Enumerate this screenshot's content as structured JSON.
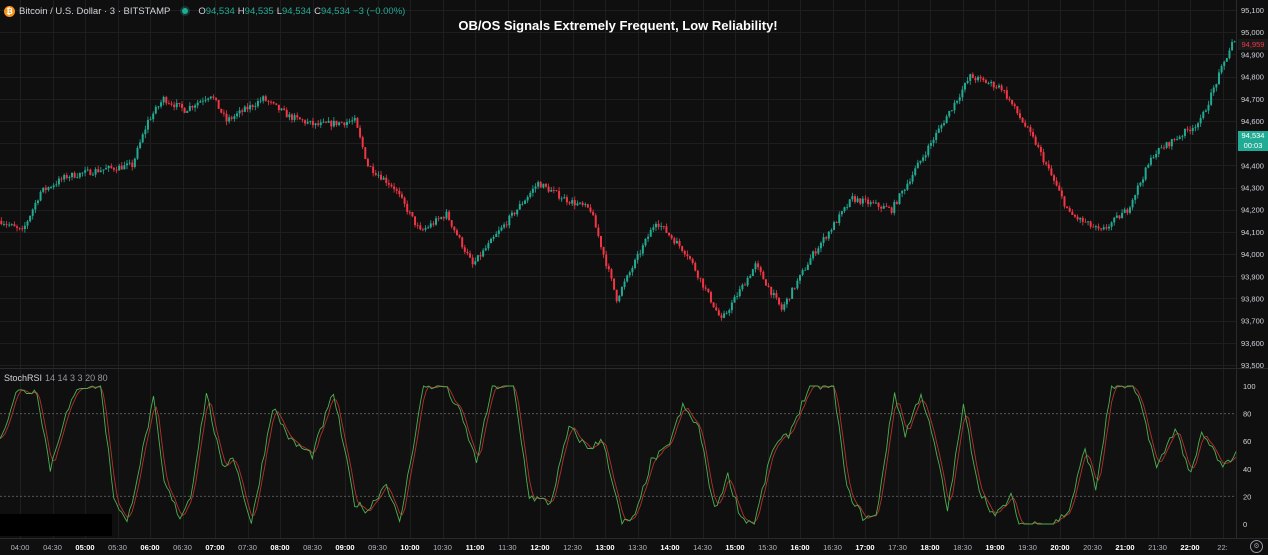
{
  "legend": {
    "symbol": "Bitcoin / U.S. Dollar · 3 · BITSTAMP",
    "icon": "bitcoin-icon",
    "status_color": "#22ab94",
    "o_label": "O",
    "o_value": "94,534",
    "h_label": "H",
    "h_value": "94,535",
    "l_label": "L",
    "l_value": "94,534",
    "c_label": "C",
    "c_value": "94,534",
    "change": "−3 (−0.00%)"
  },
  "title": "OB/OS Signals Extremely Frequent, Low Reliability!",
  "price_axis": {
    "labels": [
      "95,100",
      "95,000",
      "94,900",
      "94,800",
      "94,700",
      "94,600",
      "94,500",
      "94,400",
      "94,300",
      "94,200",
      "94,100",
      "94,000",
      "93,900",
      "93,800",
      "93,700",
      "93,600",
      "93,500"
    ],
    "last_price": "94,534",
    "countdown": "00:03",
    "high_marker": "94,959"
  },
  "indicator": {
    "name": "StochRSI",
    "params": "14 14 3 3 20 80",
    "levels": [
      "100",
      "80",
      "60",
      "40",
      "20",
      "0"
    ]
  },
  "time_axis": {
    "labels": [
      "04:00",
      "04:30",
      "05:00",
      "05:30",
      "06:00",
      "06:30",
      "07:00",
      "07:30",
      "08:00",
      "08:30",
      "09:00",
      "09:30",
      "10:00",
      "10:30",
      "11:00",
      "11:30",
      "12:00",
      "12:30",
      "13:00",
      "13:30",
      "14:00",
      "14:30",
      "15:00",
      "15:30",
      "16:00",
      "16:30",
      "17:00",
      "17:30",
      "18:00",
      "18:30",
      "19:00",
      "19:30",
      "20:00",
      "20:30",
      "21:00",
      "21:30",
      "22:00",
      "22:"
    ],
    "bold": [
      "05:00",
      "06:00",
      "07:00",
      "08:00",
      "09:00",
      "10:00",
      "11:00",
      "12:00",
      "13:00",
      "14:00",
      "15:00",
      "16:00",
      "17:00",
      "18:00",
      "19:00",
      "20:00",
      "21:00",
      "22:00"
    ]
  },
  "colors": {
    "up": "#22ab94",
    "down": "#f23645",
    "k_line": "#4caf50",
    "d_line": "#b2302f",
    "background": "#0f0f0f",
    "grid": "#1e1e1e"
  },
  "chart_data": {
    "type": "candlestick",
    "x_range": [
      "03:48",
      "22:33"
    ],
    "price_range": [
      93500,
      95100
    ],
    "anchors": [
      [
        0,
        94150
      ],
      [
        8,
        94100
      ],
      [
        15,
        94280
      ],
      [
        25,
        94350
      ],
      [
        38,
        94380
      ],
      [
        50,
        94400
      ],
      [
        56,
        94600
      ],
      [
        62,
        94700
      ],
      [
        70,
        94650
      ],
      [
        80,
        94720
      ],
      [
        86,
        94600
      ],
      [
        100,
        94700
      ],
      [
        110,
        94620
      ],
      [
        120,
        94580
      ],
      [
        135,
        94600
      ],
      [
        140,
        94400
      ],
      [
        150,
        94300
      ],
      [
        160,
        94100
      ],
      [
        170,
        94180
      ],
      [
        180,
        93950
      ],
      [
        190,
        94100
      ],
      [
        205,
        94320
      ],
      [
        215,
        94250
      ],
      [
        225,
        94200
      ],
      [
        235,
        93800
      ],
      [
        250,
        94150
      ],
      [
        262,
        94000
      ],
      [
        275,
        93700
      ],
      [
        288,
        93950
      ],
      [
        298,
        93750
      ],
      [
        310,
        94000
      ],
      [
        325,
        94250
      ],
      [
        340,
        94200
      ],
      [
        355,
        94500
      ],
      [
        370,
        94800
      ],
      [
        382,
        94750
      ],
      [
        395,
        94500
      ],
      [
        408,
        94180
      ],
      [
        420,
        94100
      ],
      [
        430,
        94200
      ],
      [
        440,
        94450
      ],
      [
        458,
        94600
      ],
      [
        470,
        94950
      ]
    ],
    "stoch_range": [
      0,
      100
    ],
    "k_anchors": [
      [
        0,
        60
      ],
      [
        6,
        96
      ],
      [
        14,
        96
      ],
      [
        19,
        40
      ],
      [
        24,
        75
      ],
      [
        30,
        100
      ],
      [
        38,
        100
      ],
      [
        43,
        20
      ],
      [
        48,
        0
      ],
      [
        58,
        90
      ],
      [
        62,
        30
      ],
      [
        68,
        5
      ],
      [
        72,
        20
      ],
      [
        78,
        95
      ],
      [
        84,
        40
      ],
      [
        88,
        50
      ],
      [
        95,
        0
      ],
      [
        103,
        85
      ],
      [
        110,
        60
      ],
      [
        118,
        50
      ],
      [
        126,
        95
      ],
      [
        134,
        15
      ],
      [
        139,
        10
      ],
      [
        146,
        30
      ],
      [
        151,
        0
      ],
      [
        160,
        100
      ],
      [
        168,
        100
      ],
      [
        174,
        80
      ],
      [
        180,
        45
      ],
      [
        186,
        100
      ],
      [
        194,
        100
      ],
      [
        200,
        20
      ],
      [
        208,
        15
      ],
      [
        215,
        70
      ],
      [
        222,
        55
      ],
      [
        228,
        60
      ],
      [
        235,
        0
      ],
      [
        240,
        5
      ],
      [
        246,
        45
      ],
      [
        252,
        55
      ],
      [
        258,
        85
      ],
      [
        264,
        70
      ],
      [
        270,
        10
      ],
      [
        275,
        35
      ],
      [
        280,
        5
      ],
      [
        285,
        0
      ],
      [
        292,
        55
      ],
      [
        298,
        65
      ],
      [
        306,
        100
      ],
      [
        315,
        100
      ],
      [
        320,
        25
      ],
      [
        326,
        5
      ],
      [
        331,
        5
      ],
      [
        338,
        95
      ],
      [
        342,
        65
      ],
      [
        348,
        95
      ],
      [
        354,
        50
      ],
      [
        358,
        10
      ],
      [
        364,
        85
      ],
      [
        370,
        25
      ],
      [
        376,
        5
      ],
      [
        382,
        20
      ],
      [
        385,
        0
      ],
      [
        398,
        0
      ],
      [
        404,
        10
      ],
      [
        410,
        55
      ],
      [
        414,
        25
      ],
      [
        420,
        100
      ],
      [
        428,
        100
      ],
      [
        432,
        80
      ],
      [
        437,
        40
      ],
      [
        444,
        70
      ],
      [
        450,
        35
      ],
      [
        454,
        65
      ],
      [
        458,
        55
      ],
      [
        462,
        40
      ],
      [
        466,
        50
      ]
    ]
  }
}
